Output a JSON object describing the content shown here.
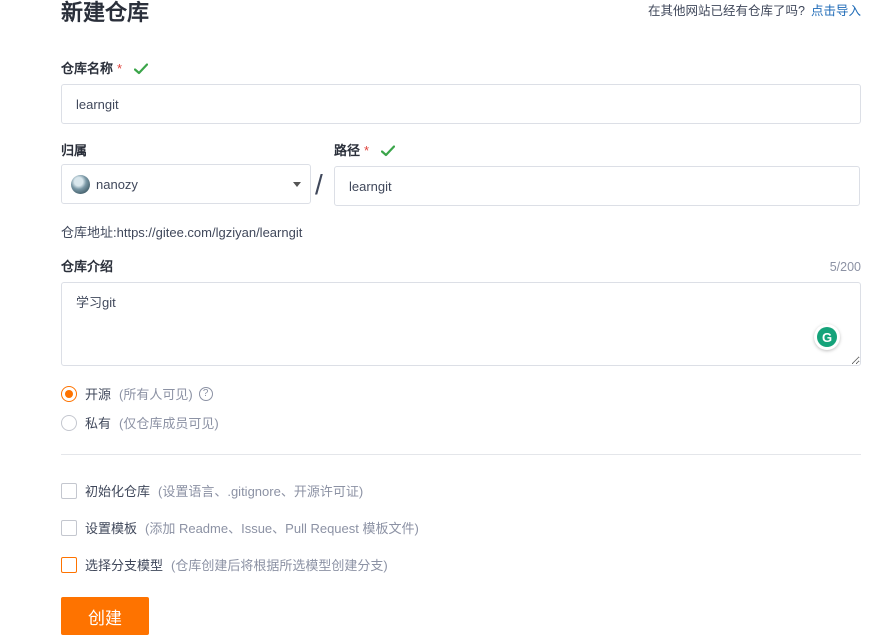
{
  "header": {
    "title": "新建仓库",
    "import_question": "在其他网站已经有仓库了吗?",
    "import_link": "点击导入"
  },
  "repo_name": {
    "label": "仓库名称",
    "required_mark": "*",
    "value": "learngit",
    "valid_icon": "check-icon"
  },
  "owner": {
    "label": "归属",
    "selected": "nanozy",
    "avatar_icon": "avatar"
  },
  "separator": "/",
  "path": {
    "label": "路径",
    "required_mark": "*",
    "value": "learngit",
    "valid_icon": "check-icon"
  },
  "address": {
    "text": "仓库地址:https://gitee.com/lgziyan/learngit"
  },
  "description": {
    "label": "仓库介绍",
    "counter": "5/200",
    "value": "学习git",
    "grammarly_letter": "G"
  },
  "visibility": {
    "options": [
      {
        "label": "开源",
        "hint": "(所有人可见)",
        "selected": true,
        "help": "?"
      },
      {
        "label": "私有",
        "hint": "(仅仓库成员可见)",
        "selected": false
      }
    ]
  },
  "options": [
    {
      "label": "初始化仓库",
      "hint": "(设置语言、.gitignore、开源许可证)",
      "checked": false
    },
    {
      "label": "设置模板",
      "hint": "(添加 Readme、Issue、Pull Request 模板文件)",
      "checked": false
    },
    {
      "label": "选择分支模型",
      "hint": "(仓库创建后将根据所选模型创建分支)",
      "checked": false
    }
  ],
  "submit": {
    "label": "创建"
  },
  "colors": {
    "accent": "#fe7300",
    "link": "#1f6bb7",
    "valid": "#3ba54a",
    "required": "#e0413b"
  }
}
